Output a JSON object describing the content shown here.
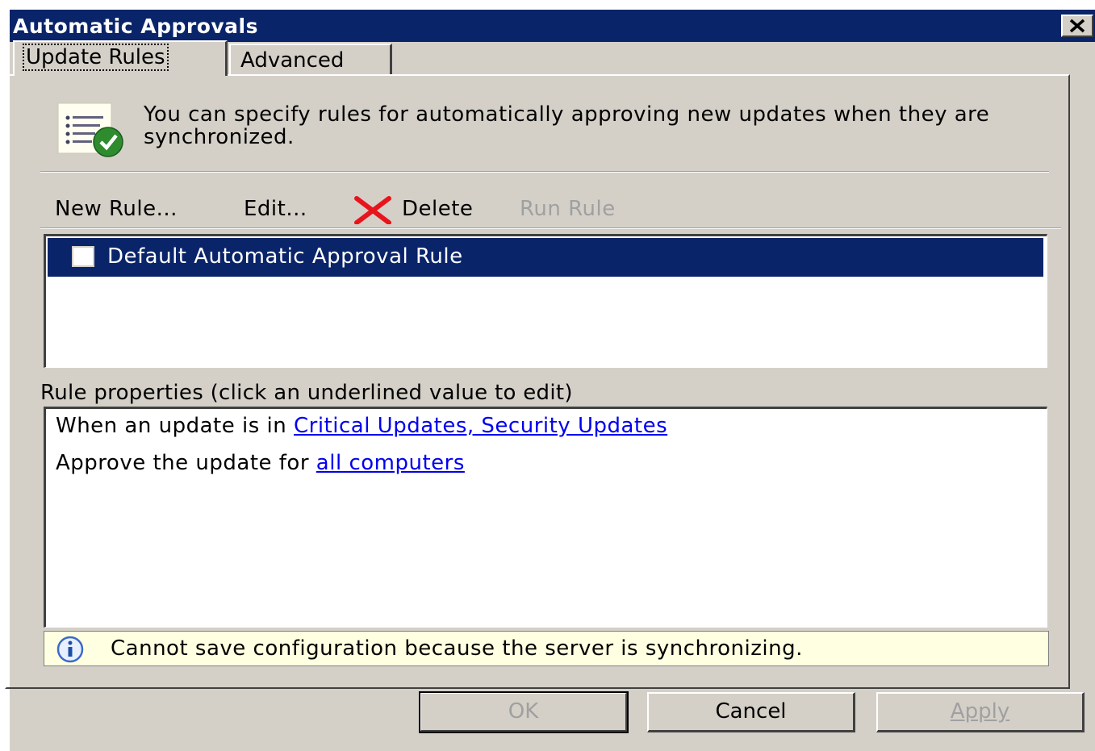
{
  "window": {
    "title": "Automatic Approvals"
  },
  "tabs": [
    {
      "label": "Update Rules",
      "active": true
    },
    {
      "label": "Advanced",
      "active": false
    }
  ],
  "intro": {
    "text": "You can specify rules for automatically approving new updates when they are synchronized."
  },
  "toolbar": {
    "new_rule": "New Rule...",
    "edit": "Edit...",
    "delete": "Delete",
    "run_rule": "Run Rule"
  },
  "rules": [
    {
      "label": "Default Automatic Approval Rule",
      "checked": false,
      "selected": true
    }
  ],
  "properties": {
    "label": "Rule properties (click an underlined value to edit)",
    "line1_prefix": "When an update is in ",
    "line1_link": "Critical Updates, Security Updates",
    "line2_prefix": "Approve the update for ",
    "line2_link": "all computers"
  },
  "info": {
    "icon": "info-icon",
    "message": "Cannot save configuration because the server is synchronizing."
  },
  "buttons": {
    "ok": "OK",
    "cancel": "Cancel",
    "apply": "Apply"
  },
  "colors": {
    "titlebar": "#0a246a",
    "dialog_bg": "#d4d0c8",
    "selection": "#0a246a",
    "link": "#0000ee",
    "infobar_bg": "#ffffe1",
    "disabled_text": "#a0a0a0"
  }
}
